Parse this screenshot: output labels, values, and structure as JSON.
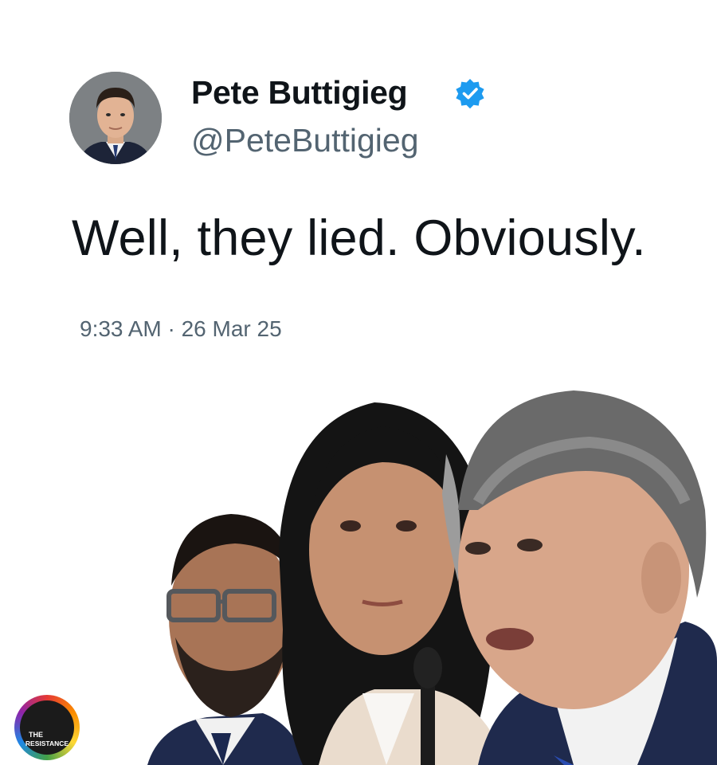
{
  "tweet": {
    "author_name": "Pete Buttigieg",
    "handle": "@PeteButtigieg",
    "verified": true,
    "text": "Well, they lied. Obviously.",
    "timestamp": "9:33 AM · 26 Mar 25"
  },
  "watermark": {
    "line1": "THE",
    "line2": "RESISTANCE"
  },
  "colors": {
    "name_text": "#0f1419",
    "secondary_text": "#536471",
    "verified_badge": "#1d9bf0",
    "suit_navy": "#1f2a4d"
  },
  "icons": {
    "verified": "verified-badge-icon"
  }
}
